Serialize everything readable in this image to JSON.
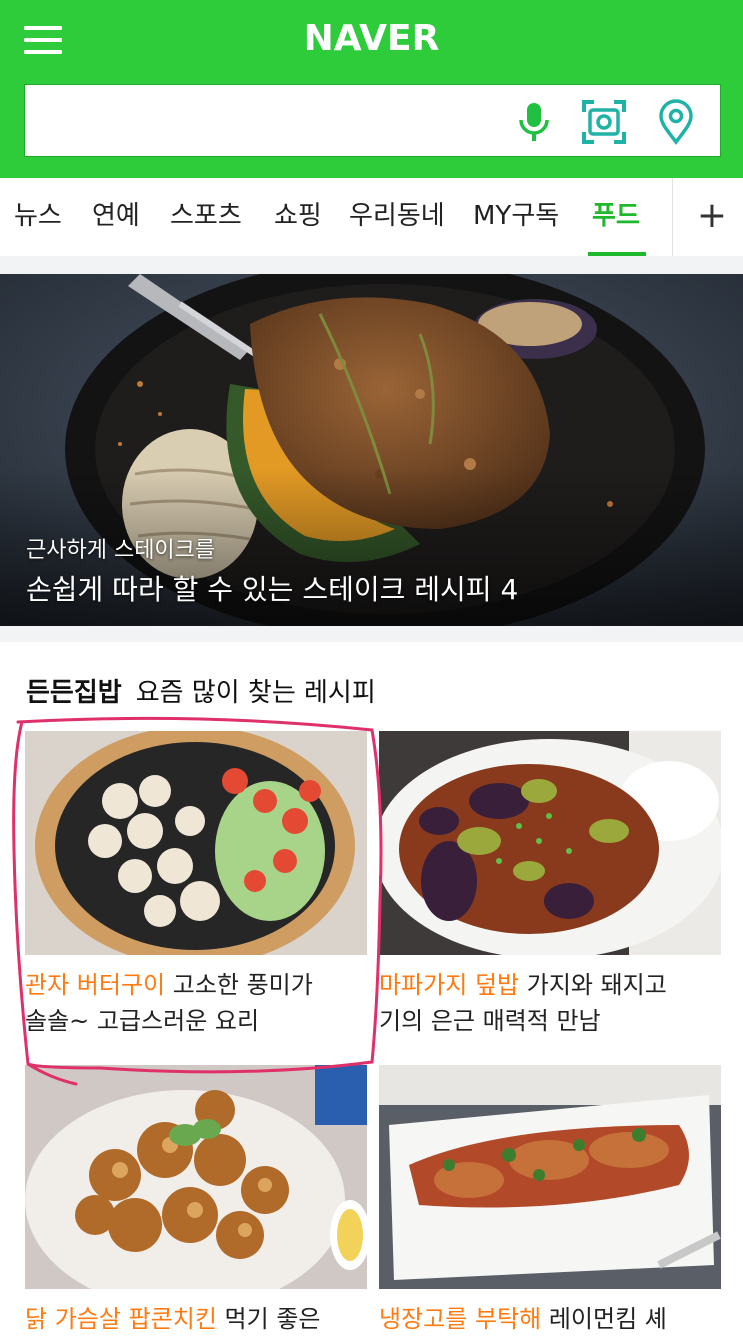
{
  "header": {
    "logo": "NAVER",
    "search": {
      "value": "",
      "placeholder": ""
    },
    "icons": [
      "menu-icon",
      "microphone-icon",
      "lens-icon",
      "location-pin-icon"
    ],
    "brand_color": "#2ecb3a"
  },
  "nav": {
    "tabs": [
      {
        "label": "뉴스"
      },
      {
        "label": "연예"
      },
      {
        "label": "스포츠"
      },
      {
        "label": "쇼핑"
      },
      {
        "label": "우리동네"
      },
      {
        "label": "MY구독"
      },
      {
        "label": "푸드",
        "active": true
      }
    ],
    "plus": "+",
    "active_color": "#1fb82c"
  },
  "hero": {
    "subtitle": "근사하게 스테이크를",
    "title": "손쉽게 따라 할 수 있는 스테이크 레시피 4"
  },
  "section": {
    "title": "든든집밥",
    "subtitle": "요즘 많이 찾는 레시피"
  },
  "cards": [
    {
      "highlight": "관자 버터구이",
      "line1": " 고소한 풍미가",
      "line2": "솔솔~ 고급스러운 요리"
    },
    {
      "highlight": "마파가지 덮밥",
      "line1": " 가지와 돼지고",
      "line2": "기의 은근 매력적 만남"
    },
    {
      "highlight": "닭 가슴살 팝콘치킨",
      "line1": " 먹기 좋은",
      "line2": ""
    },
    {
      "highlight": "냉장고를 부탁해",
      "line1": " 레이먼킴 셰",
      "line2": ""
    }
  ],
  "colors": {
    "highlight": "#ff7b12",
    "annotation": "#e0306a"
  }
}
